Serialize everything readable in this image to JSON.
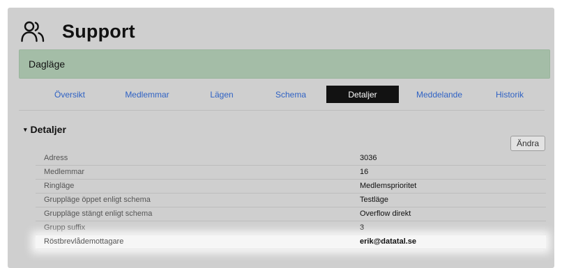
{
  "header": {
    "title": "Support",
    "icon": "users-icon"
  },
  "banner": {
    "text": "Dagläge"
  },
  "tabs": [
    {
      "label": "Översikt",
      "active": false
    },
    {
      "label": "Medlemmar",
      "active": false
    },
    {
      "label": "Lägen",
      "active": false
    },
    {
      "label": "Schema",
      "active": false
    },
    {
      "label": "Detaljer",
      "active": true
    },
    {
      "label": "Meddelande",
      "active": false
    },
    {
      "label": "Historik",
      "active": false
    }
  ],
  "section": {
    "caret": "▾",
    "title": "Detaljer",
    "edit_label": "Ändra"
  },
  "details": [
    {
      "key": "Adress",
      "value": "3036"
    },
    {
      "key": "Medlemmar",
      "value": "16"
    },
    {
      "key": "Ringläge",
      "value": "Medlemsprioritet"
    },
    {
      "key": "Gruppläge öppet enligt schema",
      "value": "Testläge"
    },
    {
      "key": "Gruppläge stängt enligt schema",
      "value": "Overflow direkt"
    },
    {
      "key": "Grupp suffix",
      "value": "3"
    },
    {
      "key": "Röstbrevlådemottagare",
      "value": "erik@datatal.se"
    }
  ],
  "colors": {
    "panel_bg": "#cfcfcf",
    "banner_bg": "#a4bda7",
    "tab_link": "#2f62c4",
    "tab_active_bg": "#121212"
  }
}
